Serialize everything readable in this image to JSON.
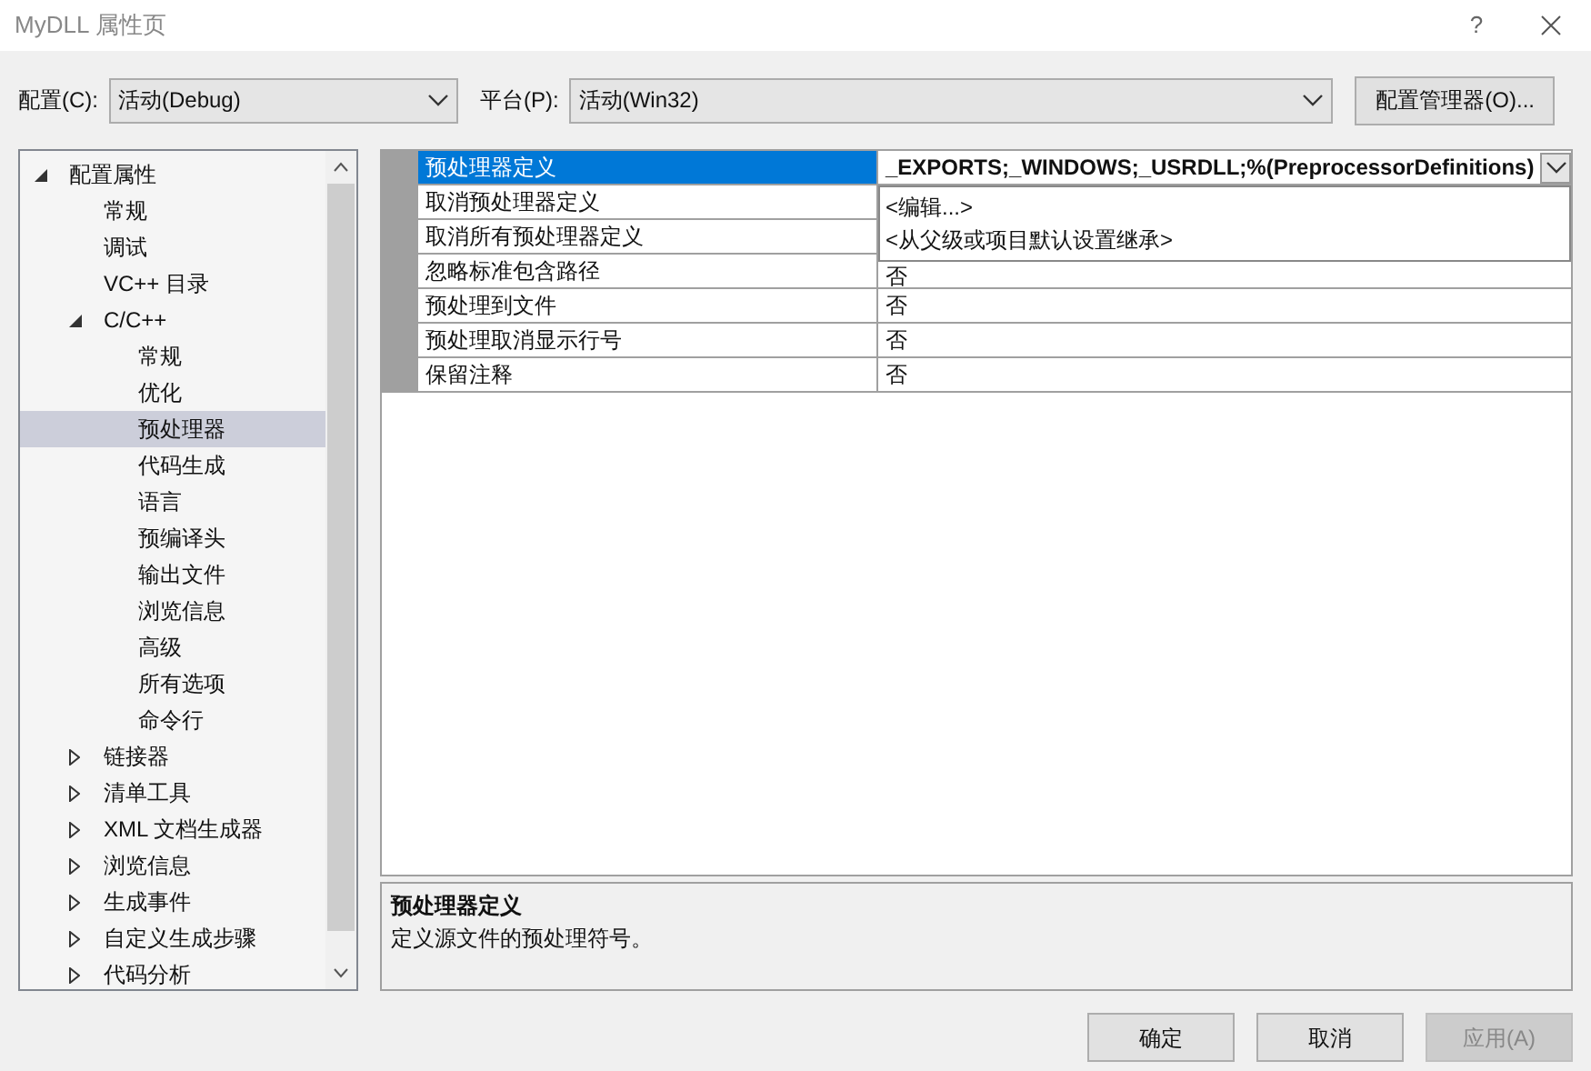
{
  "window": {
    "title": "MyDLL 属性页",
    "help": "?"
  },
  "config": {
    "label": "配置(C):",
    "value": "活动(Debug)"
  },
  "platform": {
    "label": "平台(P):",
    "value": "活动(Win32)"
  },
  "config_manager": "配置管理器(O)...",
  "tree": [
    {
      "label": "配置属性",
      "expanded": true,
      "selected": false,
      "children": [
        {
          "label": "常规",
          "selected": false
        },
        {
          "label": "调试",
          "selected": false
        },
        {
          "label": "VC++ 目录",
          "selected": false
        },
        {
          "label": "C/C++",
          "expanded": true,
          "selected": false,
          "children": [
            {
              "label": "常规",
              "selected": false
            },
            {
              "label": "优化",
              "selected": false
            },
            {
              "label": "预处理器",
              "selected": true
            },
            {
              "label": "代码生成",
              "selected": false
            },
            {
              "label": "语言",
              "selected": false
            },
            {
              "label": "预编译头",
              "selected": false
            },
            {
              "label": "输出文件",
              "selected": false
            },
            {
              "label": "浏览信息",
              "selected": false
            },
            {
              "label": "高级",
              "selected": false
            },
            {
              "label": "所有选项",
              "selected": false
            },
            {
              "label": "命令行",
              "selected": false
            }
          ]
        },
        {
          "label": "链接器",
          "expanded": false,
          "selected": false
        },
        {
          "label": "清单工具",
          "expanded": false,
          "selected": false
        },
        {
          "label": "XML 文档生成器",
          "expanded": false,
          "selected": false
        },
        {
          "label": "浏览信息",
          "expanded": false,
          "selected": false
        },
        {
          "label": "生成事件",
          "expanded": false,
          "selected": false
        },
        {
          "label": "自定义生成步骤",
          "expanded": false,
          "selected": false
        },
        {
          "label": "代码分析",
          "expanded": false,
          "selected": false
        }
      ]
    }
  ],
  "grid": {
    "rows": [
      {
        "name": "预处理器定义",
        "value": "_EXPORTS;_WINDOWS;_USRDLL;%(PreprocessorDefinitions)",
        "selected": true
      },
      {
        "name": "取消预处理器定义",
        "selected": false
      },
      {
        "name": "取消所有预处理器定义",
        "selected": false
      },
      {
        "name": "忽略标准包含路径",
        "value": "否",
        "selected": false
      },
      {
        "name": "预处理到文件",
        "value": "否",
        "selected": false
      },
      {
        "name": "预处理取消显示行号",
        "value": "否",
        "selected": false
      },
      {
        "name": "保留注释",
        "value": "否",
        "selected": false
      }
    ],
    "dropdown": [
      "<编辑...>",
      "<从父级或项目默认设置继承>"
    ]
  },
  "description": {
    "title": "预处理器定义",
    "text": "定义源文件的预处理符号。"
  },
  "buttons": [
    {
      "label": "确定",
      "disabled": false
    },
    {
      "label": "取消",
      "disabled": false
    },
    {
      "label": "应用(A)",
      "disabled": true
    }
  ]
}
